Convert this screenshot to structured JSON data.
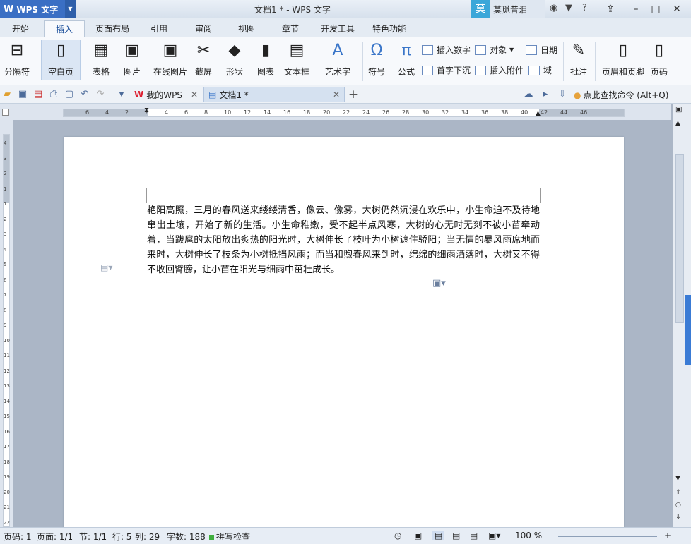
{
  "app": {
    "logo": "W",
    "name": "WPS 文字",
    "title": "文档1 * - WPS 文字"
  },
  "user": {
    "avatar": "莫",
    "name": "莫觅昔泪"
  },
  "tabs": [
    "开始",
    "插入",
    "页面布局",
    "引用",
    "审阅",
    "视图",
    "章节",
    "开发工具",
    "特色功能"
  ],
  "ribbon": {
    "big": [
      "分隔符",
      "空白页",
      "表格",
      "图片",
      "在线图片",
      "截屏",
      "形状",
      "图表",
      "文本框",
      "艺术字",
      "符号",
      "公式",
      "批注",
      "页眉和页脚",
      "页码"
    ],
    "small": [
      "插入数字",
      "对象",
      "日期",
      "首字下沉",
      "插入附件",
      "域"
    ]
  },
  "doc_tabs": [
    "我的WPS",
    "文档1 *"
  ],
  "search": "点此查找命令 (Alt+Q)",
  "ruler": {
    "h_ticks": [
      "6",
      "4",
      "2",
      "2",
      "4",
      "6",
      "8",
      "10",
      "12",
      "14",
      "16",
      "18",
      "20",
      "22",
      "24",
      "26",
      "28",
      "30",
      "32",
      "34",
      "36",
      "38",
      "40",
      "42",
      "44",
      "46"
    ],
    "v_ticks": [
      "4",
      "3",
      "2",
      "1",
      "1",
      "2",
      "3",
      "4",
      "5",
      "6",
      "7",
      "8",
      "9",
      "10",
      "11",
      "12",
      "13",
      "14",
      "15",
      "16",
      "17",
      "18",
      "19",
      "20",
      "21",
      "22"
    ]
  },
  "document": {
    "text": "艳阳高照，三月的春风送来缕缕清香，像云、像雾，大树仍然沉浸在欢乐中，小生命迫不及待地窜出土壤，开始了新的生活。小生命稚嫩，受不起半点风寒，大树的心无时无刻不被小苗牵动着，当跋扈的太阳放出炙热的阳光时，大树伸长了枝叶为小树遮住骄阳；当无情的暴风雨席地而来时，大树伸长了枝条为小树抵挡风雨；而当和煦春风来到时，绵绵的细雨洒落时，大树又不得不收回臂膀，让小苗在阳光与细雨中茁壮成长。"
  },
  "status": {
    "page_no": "页码: 1",
    "pages": "页面: 1/1",
    "section": "节: 1/1",
    "row": "行: 5",
    "col": "列: 29",
    "words": "字数: 188",
    "spell": "拼写检查",
    "zoom": "100 %"
  }
}
